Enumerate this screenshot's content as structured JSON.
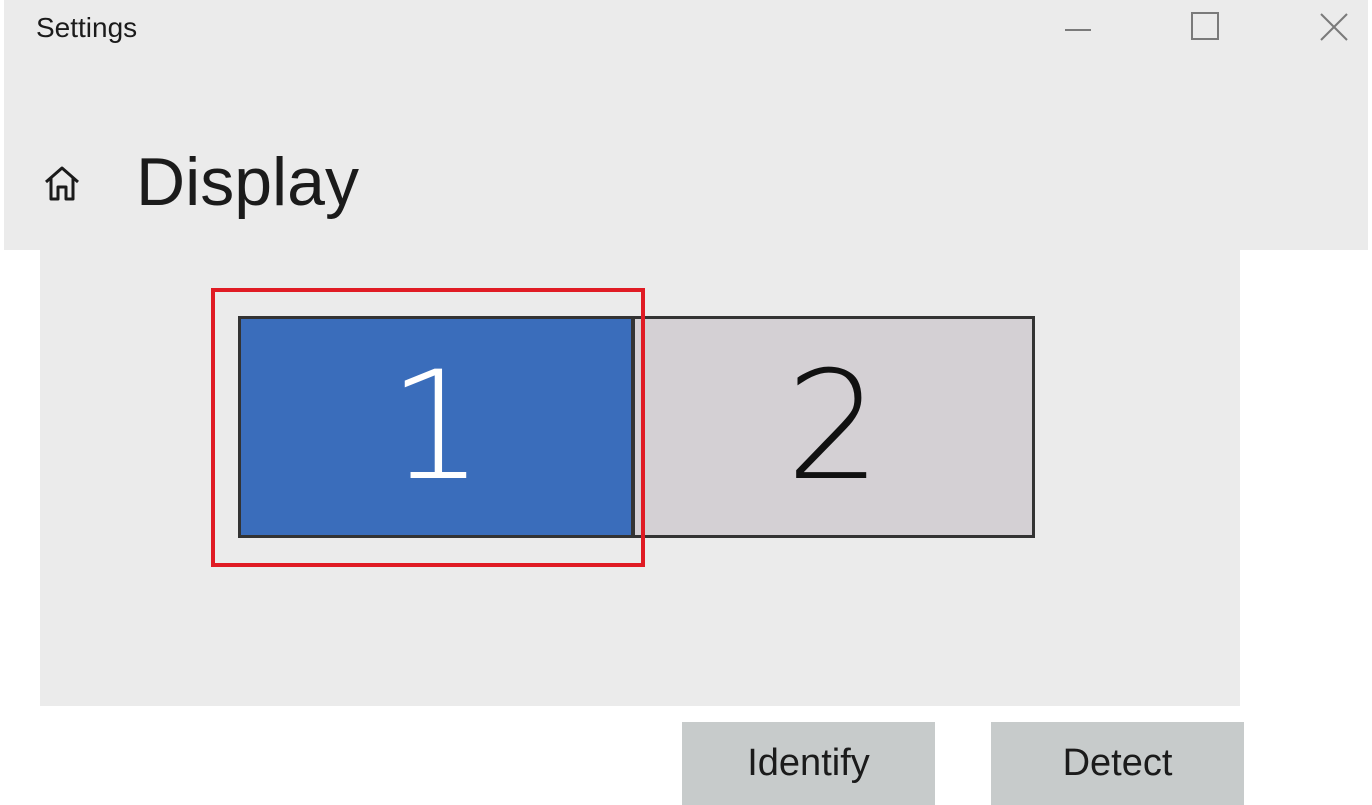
{
  "window": {
    "title": "Settings",
    "controls": {
      "minimize_icon": "minimize-icon",
      "maximize_icon": "maximize-icon",
      "close_icon": "close-icon"
    }
  },
  "page": {
    "home_icon": "home-icon",
    "title": "Display"
  },
  "arrangement": {
    "monitors": [
      {
        "label": "1",
        "selected": true,
        "color": "#3a6dbb"
      },
      {
        "label": "2",
        "selected": false,
        "color": "#d4d0d4"
      }
    ],
    "highlight_color": "#e01b24"
  },
  "buttons": {
    "identify": "Identify",
    "detect": "Detect"
  }
}
